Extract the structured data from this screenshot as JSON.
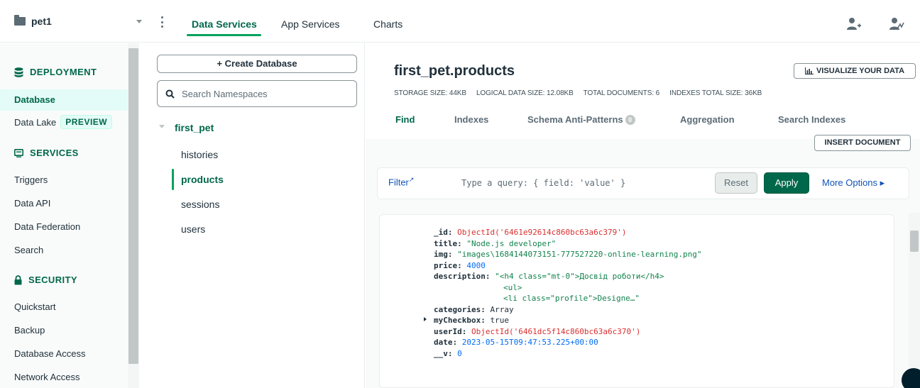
{
  "topbar": {
    "project": "pet1",
    "tabs": [
      {
        "label": "Data Services",
        "active": true
      },
      {
        "label": "App Services",
        "active": false
      },
      {
        "label": "Charts",
        "active": false
      }
    ]
  },
  "leftnav": {
    "deployment": {
      "title": "DEPLOYMENT",
      "items": [
        {
          "label": "Database",
          "active": true
        },
        {
          "label": "Data Lake",
          "badge": "PREVIEW"
        }
      ]
    },
    "services": {
      "title": "SERVICES",
      "items": [
        "Triggers",
        "Data API",
        "Data Federation",
        "Search"
      ]
    },
    "security": {
      "title": "SECURITY",
      "items": [
        "Quickstart",
        "Backup",
        "Database Access",
        "Network Access"
      ]
    }
  },
  "namespaces": {
    "create_label": "+ Create Database",
    "search_placeholder": "Search Namespaces",
    "database": "first_pet",
    "collections": [
      "histories",
      "products",
      "sessions",
      "users"
    ],
    "active_collection": "products"
  },
  "collection": {
    "title": "first_pet.products",
    "visualize_label": "VISUALIZE YOUR DATA",
    "stats": [
      "STORAGE SIZE: 44KB",
      "LOGICAL DATA SIZE: 12.08KB",
      "TOTAL DOCUMENTS: 6",
      "INDEXES TOTAL SIZE: 36KB"
    ],
    "tabs": [
      {
        "label": "Find",
        "active": true
      },
      {
        "label": "Indexes"
      },
      {
        "label": "Schema Anti-Patterns",
        "badge": "0"
      },
      {
        "label": "Aggregation"
      },
      {
        "label": "Search Indexes"
      }
    ],
    "insert_label": "INSERT DOCUMENT"
  },
  "filter": {
    "label": "Filter",
    "placeholder": "Type a query: { field: 'value' }",
    "reset_label": "Reset",
    "apply_label": "Apply",
    "more_options_label": "More Options ▸"
  },
  "document": {
    "id_key": "_id:",
    "id_value": "ObjectId('6461e92614c860bc63a6c379')",
    "title_key": "title:",
    "title_value": "\"Node.js developer\"",
    "img_key": "img:",
    "img_value": "\"images\\1684144073151-777527220-online-learning.png\"",
    "price_key": "price:",
    "price_value": "4000",
    "desc_key": "description:",
    "desc_line1": "\"<h4 class=\"mt-0\">Досвід роботи</h4>",
    "desc_line2": "<ul>",
    "desc_line3": "<li class=\"profile\">Designe…\"",
    "categories_key": "categories:",
    "categories_value": "Array",
    "checkbox_key": "myCheckbox:",
    "checkbox_value": "true",
    "user_key": "userId:",
    "user_value": "ObjectId('6461dc5f14c860bc63a6c370')",
    "date_key": "date:",
    "date_value": "2023-05-15T09:47:53.225+00:00",
    "v_key": "__v:",
    "v_value": "0"
  },
  "colors": {
    "accent": "#00684a",
    "link": "#1254b7",
    "object_id": "#db3030",
    "string": "#12824d",
    "number": "#016bf8"
  }
}
